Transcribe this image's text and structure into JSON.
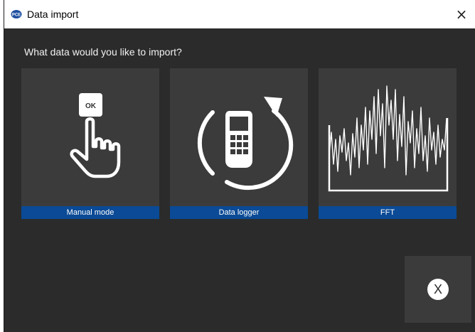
{
  "window": {
    "title": "Data import",
    "close_glyph": "×"
  },
  "main": {
    "question": "What data would you like to import?"
  },
  "options": [
    {
      "label": "Manual mode",
      "icon": "hand-press-ok-icon",
      "button_text": "OK"
    },
    {
      "label": "Data logger",
      "icon": "data-logger-device-icon"
    },
    {
      "label": "FFT",
      "icon": "fft-waveform-icon"
    }
  ],
  "cancel": {
    "glyph": "X"
  },
  "colors": {
    "background": "#2b2b2b",
    "tile": "#3b3b3b",
    "label_bar": "#0a4a96",
    "titlebar": "#ffffff"
  }
}
